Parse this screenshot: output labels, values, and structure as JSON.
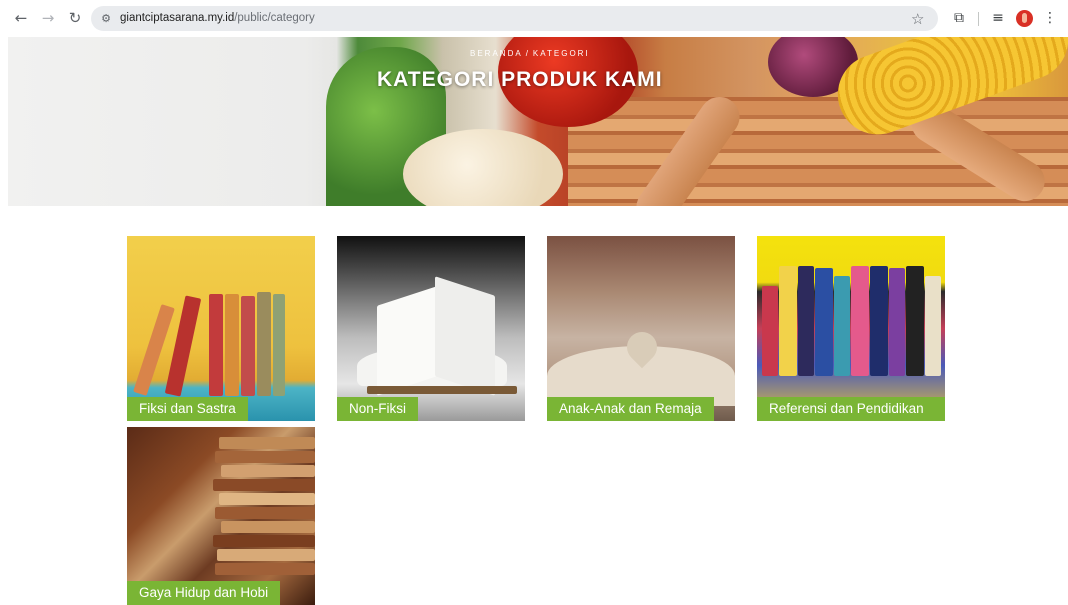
{
  "browser": {
    "url_host": "giantciptasarana.my.id",
    "url_path": "/public/category"
  },
  "hero": {
    "breadcrumb_home": "BERANDA",
    "breadcrumb_separator": "/",
    "breadcrumb_current": "KATEGORI",
    "title": "KATEGORI PRODUK KAMI"
  },
  "categories": [
    {
      "label": "Fiksi dan Sastra"
    },
    {
      "label": "Non-Fiksi"
    },
    {
      "label": "Anak-Anak dan Remaja"
    },
    {
      "label": "Referensi dan Pendidikan"
    },
    {
      "label": "Gaya Hidup dan Hobi"
    }
  ],
  "colors": {
    "accent": "#7ab535",
    "omnibox": "#e9ebee"
  },
  "icons": {
    "back": "arrow-left-icon",
    "forward": "arrow-right-icon",
    "reload": "reload-icon",
    "site_info": "tune-icon",
    "bookmark": "star-icon",
    "extensions": "puzzle-icon",
    "media": "media-queue-icon",
    "profile": "avatar",
    "menu": "kebab-menu-icon"
  }
}
